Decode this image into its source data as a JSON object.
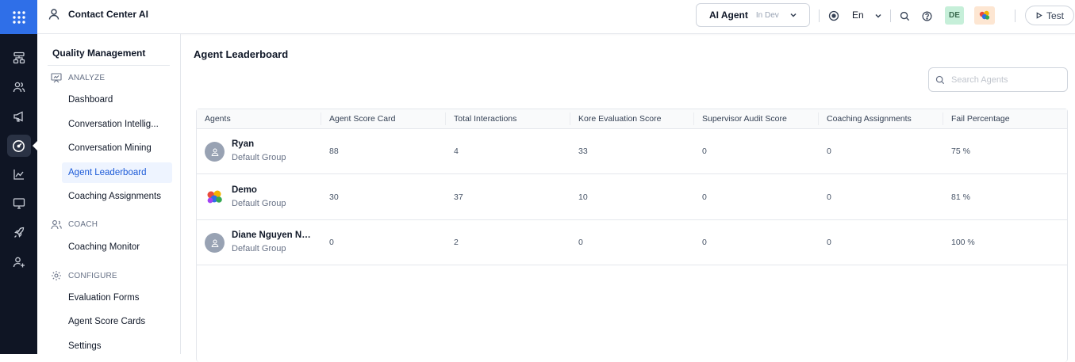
{
  "header": {
    "app_title": "Contact Center AI",
    "agent_name": "AI Agent",
    "agent_env": "In Dev",
    "language": "En",
    "user_initials": "DE",
    "test_label": "Test"
  },
  "rail": {
    "items": [
      "hierarchy-icon",
      "users-icon",
      "megaphone-icon",
      "gauge-icon",
      "analytics-icon",
      "monitor-icon",
      "rocket-icon",
      "add-user-icon"
    ],
    "active_index": 3
  },
  "sidebar": {
    "title": "Quality Management",
    "sections": [
      {
        "label": "ANALYZE",
        "items": [
          "Dashboard",
          "Conversation Intellig...",
          "Conversation Mining",
          "Agent Leaderboard",
          "Coaching Assignments"
        ]
      },
      {
        "label": "COACH",
        "items": [
          "Coaching Monitor"
        ]
      },
      {
        "label": "CONFIGURE",
        "items": [
          "Evaluation Forms",
          "Agent Score Cards",
          "Settings"
        ]
      }
    ],
    "active_item": "Agent Leaderboard"
  },
  "main": {
    "title": "Agent Leaderboard",
    "search_placeholder": "Search Agents",
    "columns": [
      "Agents",
      "Agent Score Card",
      "Total Interactions",
      "Kore Evaluation Score",
      "Supervisor Audit Score",
      "Coaching Assignments",
      "Fail Percentage"
    ],
    "rows": [
      {
        "name": "Ryan",
        "group": "Default Group",
        "avatar": "user-icon",
        "score_card": "88",
        "interactions": "4",
        "kore_score": "33",
        "supervisor_score": "0",
        "coaching": "0",
        "fail": "75 %"
      },
      {
        "name": "Demo",
        "group": "Default Group",
        "avatar": "balloons-icon",
        "score_card": "30",
        "interactions": "37",
        "kore_score": "10",
        "supervisor_score": "0",
        "coaching": "0",
        "fail": "81 %"
      },
      {
        "name": "Diane Nguyen Ng...",
        "group": "Default Group",
        "avatar": "user-icon",
        "score_card": "0",
        "interactions": "2",
        "kore_score": "0",
        "supervisor_score": "0",
        "coaching": "0",
        "fail": "100 %"
      }
    ]
  },
  "colors": {
    "accent": "#2f6fe8",
    "rail_bg": "#0f1524",
    "active_bg": "#eef4ff",
    "active_text": "#1d5bd8"
  }
}
